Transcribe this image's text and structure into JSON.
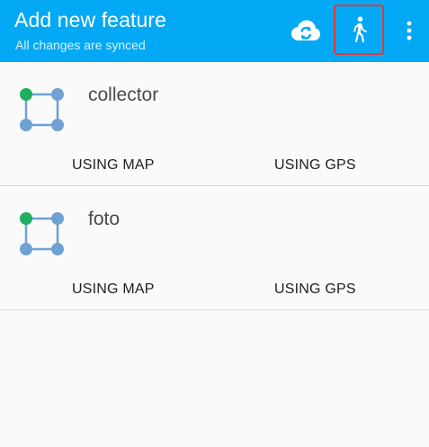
{
  "toolbar": {
    "title": "Add new feature",
    "subtitle": "All changes are synced",
    "sync_icon": "cloud-sync-icon",
    "track_icon": "walking-person-icon",
    "more_icon": "more-vert-icon",
    "highlight_color": "#e53935"
  },
  "layers": [
    {
      "name": "collector",
      "icon": "polygon-layer-icon",
      "actions": [
        "USING MAP",
        "USING GPS"
      ]
    },
    {
      "name": "foto",
      "icon": "polygon-layer-icon",
      "actions": [
        "USING MAP",
        "USING GPS"
      ]
    }
  ],
  "colors": {
    "appbar": "#03a9f4",
    "vertex_start": "#1fae5d",
    "vertex": "#6fa1d4"
  }
}
